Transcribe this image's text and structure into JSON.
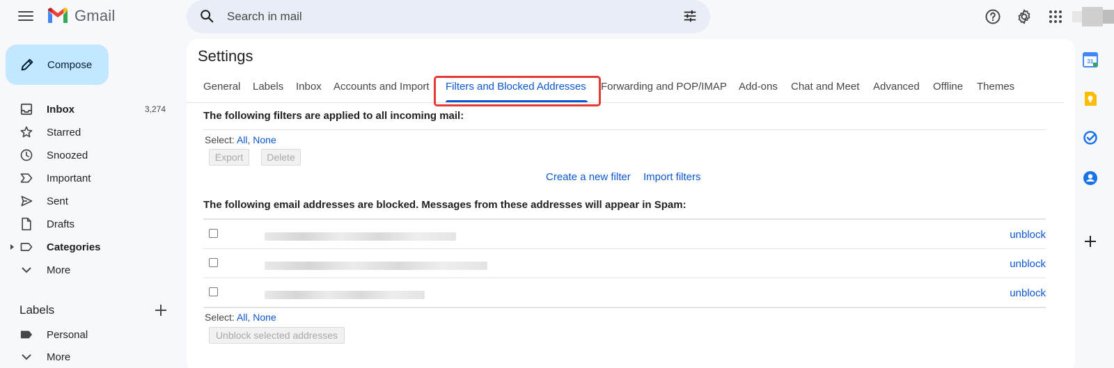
{
  "app": {
    "name": "Gmail"
  },
  "search": {
    "placeholder": "Search in mail"
  },
  "compose": {
    "label": "Compose"
  },
  "nav": {
    "items": [
      {
        "label": "Inbox",
        "count": "3,274"
      },
      {
        "label": "Starred"
      },
      {
        "label": "Snoozed"
      },
      {
        "label": "Important"
      },
      {
        "label": "Sent"
      },
      {
        "label": "Drafts"
      },
      {
        "label": "Categories"
      },
      {
        "label": "More"
      }
    ]
  },
  "labels": {
    "header": "Labels",
    "items": [
      {
        "label": "Personal"
      },
      {
        "label": "More"
      }
    ]
  },
  "settings": {
    "title": "Settings",
    "tabs": [
      "General",
      "Labels",
      "Inbox",
      "Accounts and Import",
      "Filters and Blocked Addresses",
      "Forwarding and POP/IMAP",
      "Add-ons",
      "Chat and Meet",
      "Advanced",
      "Offline",
      "Themes"
    ],
    "active_tab": "Filters and Blocked Addresses"
  },
  "filters": {
    "title": "The following filters are applied to all incoming mail:",
    "select_prefix": "Select:",
    "select_all": "All",
    "select_none": "None",
    "export_label": "Export",
    "delete_label": "Delete",
    "create_filter": "Create a new filter",
    "import_filters": "Import filters"
  },
  "blocked": {
    "title": "The following email addresses are blocked. Messages from these addresses will appear in Spam:",
    "rows": [
      {
        "action": "unblock"
      },
      {
        "action": "unblock"
      },
      {
        "action": "unblock"
      }
    ],
    "select_prefix": "Select:",
    "select_all": "All",
    "select_none": "None",
    "unblock_selected": "Unblock selected addresses"
  },
  "colors": {
    "accent": "#0b57d0",
    "compose_bg": "#c2e7ff",
    "highlight": "#e53935",
    "page_bg": "#f6f8fc"
  }
}
